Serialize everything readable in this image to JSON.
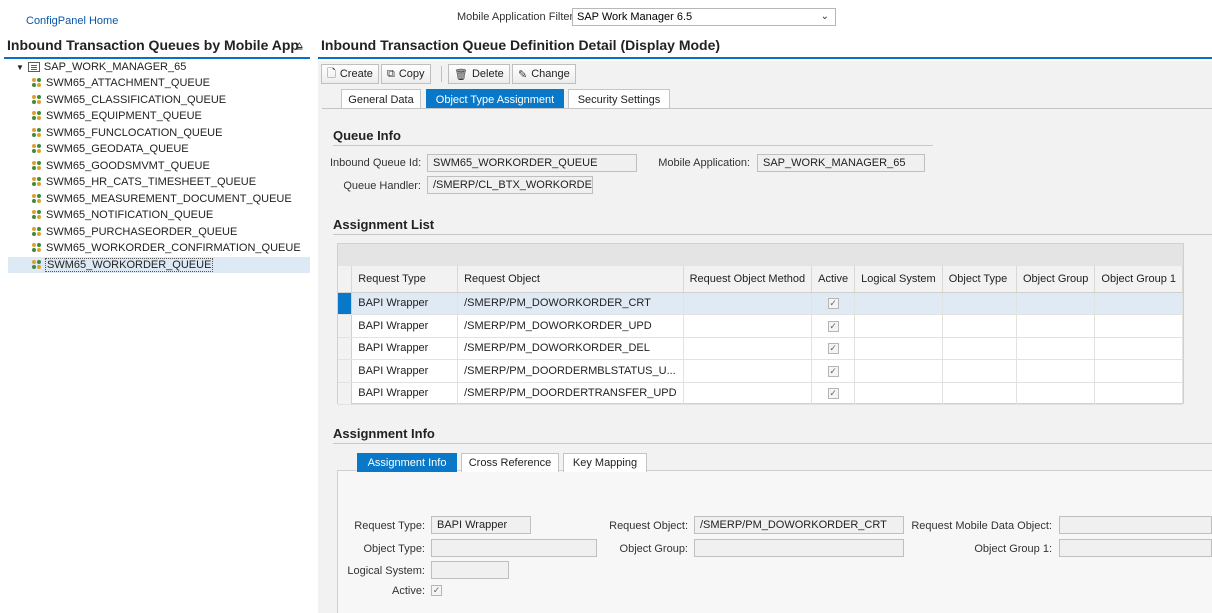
{
  "topbar": {
    "home_link": "ConfigPanel Home",
    "filter_label": "Mobile Application Filter:",
    "filter_value": "SAP Work Manager 6.5"
  },
  "left_panel": {
    "title": "Inbound Transaction Queues by Mobile App",
    "root": "SAP_WORK_MANAGER_65",
    "items": [
      "SWM65_ATTACHMENT_QUEUE",
      "SWM65_CLASSIFICATION_QUEUE",
      "SWM65_EQUIPMENT_QUEUE",
      "SWM65_FUNCLOCATION_QUEUE",
      "SWM65_GEODATA_QUEUE",
      "SWM65_GOODSMVMT_QUEUE",
      "SWM65_HR_CATS_TIMESHEET_QUEUE",
      "SWM65_MEASUREMENT_DOCUMENT_QUEUE",
      "SWM65_NOTIFICATION_QUEUE",
      "SWM65_PURCHASEORDER_QUEUE",
      "SWM65_WORKORDER_CONFIRMATION_QUEUE",
      "SWM65_WORKORDER_QUEUE"
    ],
    "selected_index": 11
  },
  "right_panel": {
    "title": "Inbound Transaction Queue Definition Detail (Display Mode)",
    "toolbar": {
      "create": "Create",
      "copy": "Copy",
      "delete": "Delete",
      "change": "Change"
    },
    "tabs": [
      "General Data",
      "Object Type Assignment",
      "Security Settings"
    ],
    "active_tab": 1
  },
  "queue_info": {
    "title": "Queue Info",
    "inbound_queue_id_label": "Inbound Queue Id:",
    "inbound_queue_id": "SWM65_WORKORDER_QUEUE",
    "mobile_app_label": "Mobile Application:",
    "mobile_app": "SAP_WORK_MANAGER_65",
    "queue_handler_label": "Queue Handler:",
    "queue_handler": "/SMERP/CL_BTX_WORKORDER_"
  },
  "assignment_list": {
    "title": "Assignment List",
    "columns": [
      "Request Type",
      "Request Object",
      "Request Object Method",
      "Active",
      "Logical System",
      "Object Type",
      "Object Group",
      "Object Group 1"
    ],
    "rows": [
      {
        "type": "BAPI Wrapper",
        "object": "/SMERP/PM_DOWORKORDER_CRT",
        "active": true
      },
      {
        "type": "BAPI Wrapper",
        "object": "/SMERP/PM_DOWORKORDER_UPD",
        "active": true
      },
      {
        "type": "BAPI Wrapper",
        "object": "/SMERP/PM_DOWORKORDER_DEL",
        "active": true
      },
      {
        "type": "BAPI Wrapper",
        "object": "/SMERP/PM_DOORDERMBLSTATUS_U...",
        "active": true
      },
      {
        "type": "BAPI Wrapper",
        "object": "/SMERP/PM_DOORDERTRANSFER_UPD",
        "active": true
      }
    ],
    "selected_row": 0
  },
  "assignment_info": {
    "title": "Assignment Info",
    "tabs": [
      "Assignment Info",
      "Cross Reference",
      "Key Mapping"
    ],
    "active_tab": 0,
    "request_type_label": "Request Type:",
    "request_type": "BAPI Wrapper",
    "request_object_label": "Request Object:",
    "request_object": "/SMERP/PM_DOWORKORDER_CRT",
    "request_mdo_label": "Request Mobile Data Object:",
    "request_mdo": "",
    "object_type_label": "Object Type:",
    "object_type": "",
    "object_group_label": "Object Group:",
    "object_group": "",
    "object_group1_label": "Object Group 1:",
    "object_group1": "",
    "logical_system_label": "Logical System:",
    "logical_system": "",
    "active_label": "Active:",
    "active": true
  }
}
